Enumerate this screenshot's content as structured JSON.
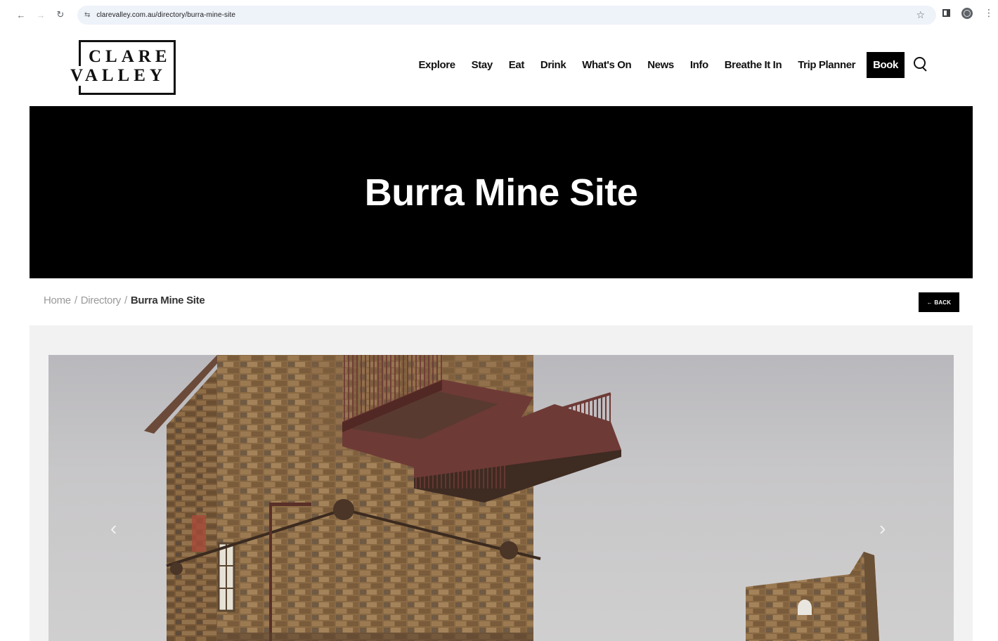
{
  "browser": {
    "url": "clarevalley.com.au/directory/burra-mine-site",
    "icons": [
      "back-arrow-icon",
      "forward-arrow-icon",
      "reload-icon",
      "site-settings-icon",
      "bookmark-star-icon",
      "side-panel-icon",
      "profile-globe-icon",
      "menu-kebab-icon"
    ]
  },
  "logo": {
    "line1": "CLARE",
    "line2": "VALLEY"
  },
  "nav": {
    "items": [
      "Explore",
      "Stay",
      "Eat",
      "Drink",
      "What's On",
      "News",
      "Info",
      "Breathe It In",
      "Trip Planner"
    ],
    "book": "Book"
  },
  "hero": {
    "title": "Burra Mine Site"
  },
  "breadcrumb": {
    "home": "Home",
    "directory": "Directory",
    "current": "Burra Mine Site",
    "separator": "/"
  },
  "back_button": "← BACK",
  "gallery": {
    "prev": "‹",
    "next": "›"
  },
  "colors": {
    "hero_bg": "#000000",
    "panel_bg": "#f2f2f2",
    "stone": "#8a6a44",
    "rail": "#6e3a36"
  }
}
